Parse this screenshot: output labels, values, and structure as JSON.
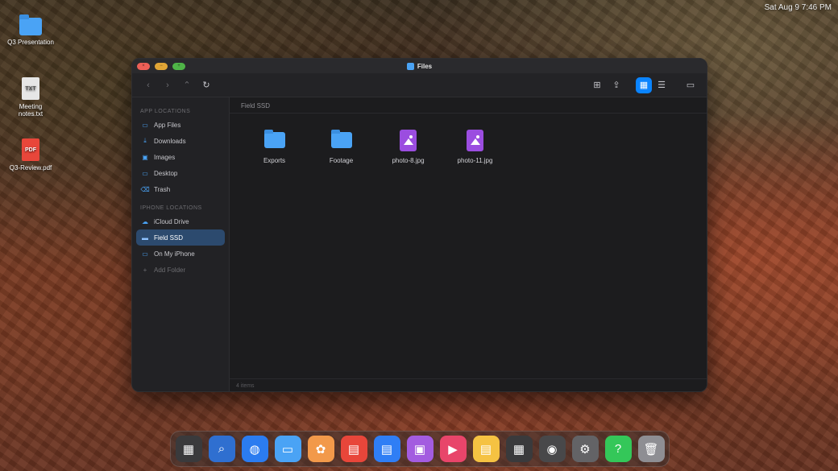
{
  "menubar": {
    "clock": "Sat Aug 9  7:46 PM"
  },
  "desktop": {
    "icons": [
      {
        "name": "folder-icon",
        "badge": "",
        "label": "Q3 Presentation",
        "type": "folder"
      },
      {
        "name": "text-file-icon",
        "badge": "TXT",
        "label": "Meeting notes.txt",
        "type": "doc"
      },
      {
        "name": "pdf-file-icon",
        "badge": "PDF",
        "label": "Q3-Review.pdf",
        "type": "pdf"
      }
    ]
  },
  "window": {
    "title": "Files",
    "traffic": {
      "close": "×",
      "minimize": "−",
      "zoom": "+"
    },
    "breadcrumb": "Field SSD",
    "status": "4 items"
  },
  "toolbar": {
    "back": "‹",
    "forward": "›",
    "up": "⌃",
    "refresh": "↻",
    "new_folder": "⊞",
    "share": "⇪",
    "grid_view": "▦",
    "list_view": "☰",
    "present": "▭"
  },
  "sidebar": {
    "app_section": "APP LOCATIONS",
    "app_items": [
      {
        "label": "App Files",
        "icon": "folder-icon",
        "glyph": "▭"
      },
      {
        "label": "Downloads",
        "icon": "download-icon",
        "glyph": "⤓"
      },
      {
        "label": "Images",
        "icon": "image-icon",
        "glyph": "▣"
      },
      {
        "label": "Desktop",
        "icon": "desktop-icon",
        "glyph": "▭"
      },
      {
        "label": "Trash",
        "icon": "trash-icon",
        "glyph": "⌫"
      }
    ],
    "phone_section": "IPHONE LOCATIONS",
    "phone_items": [
      {
        "label": "iCloud Drive",
        "icon": "cloud-icon",
        "glyph": "☁"
      },
      {
        "label": "Field SSD",
        "icon": "drive-icon",
        "glyph": "▬"
      },
      {
        "label": "On My iPhone",
        "icon": "folder-icon",
        "glyph": "▭"
      }
    ],
    "add_folder": "Add Folder",
    "add_glyph": "+"
  },
  "files": [
    {
      "name": "Exports",
      "kind": "folder"
    },
    {
      "name": "Footage",
      "kind": "folder"
    },
    {
      "name": "photo-8.jpg",
      "kind": "image"
    },
    {
      "name": "photo-11.jpg",
      "kind": "image"
    }
  ],
  "dock": [
    {
      "name": "launchpad",
      "glyph": "▦",
      "color": "#3a3a3c"
    },
    {
      "name": "search",
      "glyph": "⌕",
      "color": "#2f6fd0"
    },
    {
      "name": "browser",
      "glyph": "◍",
      "color": "#2b7cf0"
    },
    {
      "name": "files",
      "glyph": "▭",
      "color": "#4aa3f5"
    },
    {
      "name": "photos",
      "glyph": "✿",
      "color": "#f2994a"
    },
    {
      "name": "pdf",
      "glyph": "▤",
      "color": "#e8463a"
    },
    {
      "name": "docs",
      "glyph": "▤",
      "color": "#2f7ef5"
    },
    {
      "name": "gallery",
      "glyph": "▣",
      "color": "#a35ce0"
    },
    {
      "name": "video",
      "glyph": "▶",
      "color": "#e8456a"
    },
    {
      "name": "notes",
      "glyph": "▤",
      "color": "#f5c242"
    },
    {
      "name": "calculator",
      "glyph": "▦",
      "color": "#3a3a3c"
    },
    {
      "name": "camera",
      "glyph": "◉",
      "color": "#48484a"
    },
    {
      "name": "settings",
      "glyph": "⚙",
      "color": "#636366"
    },
    {
      "name": "help",
      "glyph": "?",
      "color": "#34c759"
    },
    {
      "name": "trash",
      "glyph": "🗑",
      "color": "#8e8e93"
    }
  ]
}
